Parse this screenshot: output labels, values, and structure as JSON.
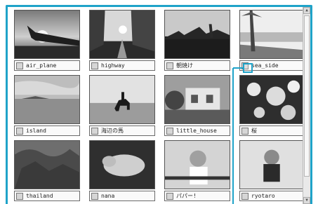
{
  "gallery": {
    "items": [
      {
        "label": "air_plane",
        "icon": "photo-air-plane"
      },
      {
        "label": "highway",
        "icon": "photo-highway"
      },
      {
        "label": "朝焼け",
        "icon": "photo-sunrise"
      },
      {
        "label": "sea_side",
        "icon": "photo-sea-side"
      },
      {
        "label": "island",
        "icon": "photo-island"
      },
      {
        "label": "海辺の馬",
        "icon": "photo-beach-horse"
      },
      {
        "label": "little_house",
        "icon": "photo-little-house"
      },
      {
        "label": "桜",
        "icon": "photo-cherry-blossom"
      },
      {
        "label": "thailand",
        "icon": "photo-thailand"
      },
      {
        "label": "nana",
        "icon": "photo-dog-nana"
      },
      {
        "label": "パパー!",
        "icon": "photo-papa"
      },
      {
        "label": "ryotaro",
        "icon": "photo-ryotaro"
      }
    ]
  },
  "colors": {
    "accent": "#1fa3c9"
  },
  "scrollbar": {
    "up_arrow": "▲",
    "down_arrow": "▼"
  }
}
